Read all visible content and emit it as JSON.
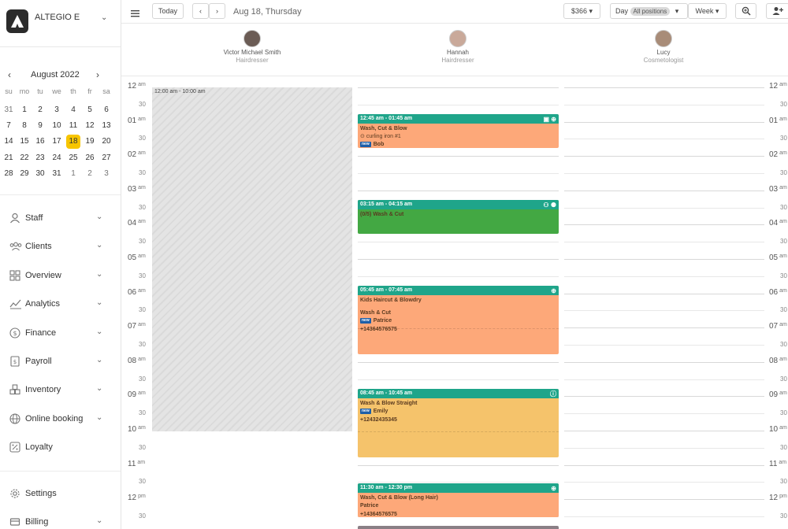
{
  "brand": {
    "name": "ALTEGIO E"
  },
  "mini_calendar": {
    "month_title": "August 2022",
    "weekdays": [
      "su",
      "mo",
      "tu",
      "we",
      "th",
      "fr",
      "sa"
    ],
    "weeks": [
      [
        "31",
        "1",
        "2",
        "3",
        "4",
        "5",
        "6"
      ],
      [
        "7",
        "8",
        "9",
        "10",
        "11",
        "12",
        "13"
      ],
      [
        "14",
        "15",
        "16",
        "17",
        "18",
        "19",
        "20"
      ],
      [
        "21",
        "22",
        "23",
        "24",
        "25",
        "26",
        "27"
      ],
      [
        "28",
        "29",
        "30",
        "31",
        "1",
        "2",
        "3"
      ]
    ],
    "selected": "18"
  },
  "nav": {
    "items": [
      {
        "label": "Staff",
        "icon": "user-icon"
      },
      {
        "label": "Clients",
        "icon": "users-icon"
      },
      {
        "label": "Overview",
        "icon": "grid-icon"
      },
      {
        "label": "Analytics",
        "icon": "chart-icon"
      },
      {
        "label": "Finance",
        "icon": "dollar-icon"
      },
      {
        "label": "Payroll",
        "icon": "payroll-icon"
      },
      {
        "label": "Inventory",
        "icon": "boxes-icon"
      },
      {
        "label": "Online booking",
        "icon": "globe-icon"
      },
      {
        "label": "Loyalty",
        "icon": "percent-icon"
      }
    ],
    "settings": {
      "label": "Settings",
      "icon": "gear-icon"
    },
    "billing": {
      "label": "Billing",
      "icon": "billing-icon"
    }
  },
  "toolbar": {
    "today": "Today",
    "date": "Aug 18, Thursday",
    "revenue": "$366",
    "view_day": "Day",
    "positions": "All positions",
    "view_week": "Week"
  },
  "staff": [
    {
      "name": "Victor Michael Smith",
      "role": "Hairdresser"
    },
    {
      "name": "Hannah",
      "role": "Hairdresser"
    },
    {
      "name": "Lucy",
      "role": "Cosmetologist"
    }
  ],
  "timeline": {
    "hours": [
      {
        "h": "12",
        "ap": "am"
      },
      {
        "h": "01",
        "ap": "am"
      },
      {
        "h": "02",
        "ap": "am"
      },
      {
        "h": "03",
        "ap": "am"
      },
      {
        "h": "04",
        "ap": "am"
      },
      {
        "h": "05",
        "ap": "am"
      },
      {
        "h": "06",
        "ap": "am"
      },
      {
        "h": "07",
        "ap": "am"
      },
      {
        "h": "08",
        "ap": "am"
      },
      {
        "h": "09",
        "ap": "am"
      },
      {
        "h": "10",
        "ap": "am"
      },
      {
        "h": "11",
        "ap": "am"
      },
      {
        "h": "12",
        "ap": "pm"
      }
    ],
    "half": "30"
  },
  "unavailable": {
    "label": "12:00 am - 10:00 am"
  },
  "appointments": [
    {
      "time": "12:45 am - 01:45 am",
      "color": "#fda879",
      "service": "Wash, Cut & Blow",
      "extra": "curling iron #1",
      "client": "Bob",
      "is_new": true,
      "phone": ""
    },
    {
      "time": "03:15 am - 04:15 am",
      "color": "#43a843",
      "service": "(0/5) Wash & Cut",
      "extra": "",
      "client": "",
      "is_new": false,
      "phone": ""
    },
    {
      "time": "05:45 am - 07:45 am",
      "color": "#fda879",
      "service": "Kids Haircut & Blowdry",
      "service2": "Wash & Cut",
      "extra": "",
      "client": "Patrice",
      "is_new": true,
      "phone": "+14364576575"
    },
    {
      "time": "08:45 am - 10:45 am",
      "color": "#f5c36b",
      "service": "Wash & Blow Straight",
      "extra": "",
      "client": "Emily",
      "is_new": true,
      "phone": "+12432435345"
    },
    {
      "time": "11:30 am - 12:30 pm",
      "color": "#fda879",
      "service": "Wash, Cut & Blow (Long Hair)",
      "extra": "",
      "client": "Patrice",
      "is_new": false,
      "phone": "+14364576575"
    }
  ],
  "new_tag": "new"
}
